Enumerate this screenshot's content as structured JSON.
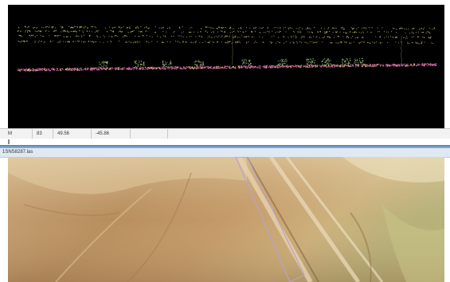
{
  "status_bar": {
    "cells": [
      "M",
      "83",
      "49.56",
      "-45.86",
      ""
    ]
  },
  "document_tab": {
    "title": "1SNS8287.las"
  },
  "colors": {
    "profile_background": "#000000",
    "ground_points": "#d95bb0",
    "canopy_points": "#d8d87a",
    "vegetation_points": "#9ec27a",
    "terrain_light": "#e8ddb8",
    "terrain_dark": "#9a6f45",
    "selection_outline": "#b7a3c9",
    "splitter": "#5a8cbf"
  },
  "icons": [
    "scroll-thumb-icon"
  ]
}
